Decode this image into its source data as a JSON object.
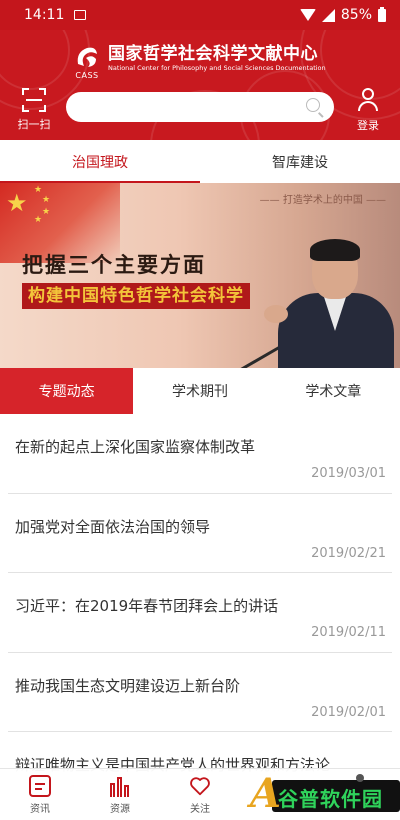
{
  "status_bar": {
    "time": "14:11",
    "battery": "85%"
  },
  "header": {
    "org_name_cn": "国家哲学社会科学文献中心",
    "org_name_en": "National Center for Philosophy and Social Sciences Documentation",
    "logo_label": "CASS",
    "scan_label": "扫一扫",
    "login_label": "登录",
    "search_placeholder": ""
  },
  "top_tabs": [
    {
      "label": "治国理政",
      "active": true
    },
    {
      "label": "智库建设",
      "active": false
    }
  ],
  "banner": {
    "tagline": "—— 打造学术上的中国 ——",
    "headline1": "把握三个主要方面",
    "headline2": "构建中国特色哲学社会科学"
  },
  "sub_tabs": [
    {
      "label": "专题动态",
      "active": true
    },
    {
      "label": "学术期刊",
      "active": false
    },
    {
      "label": "学术文章",
      "active": false
    }
  ],
  "news": [
    {
      "title": "在新的起点上深化国家监察体制改革",
      "date": "2019/03/01"
    },
    {
      "title": "加强党对全面依法治国的领导",
      "date": "2019/02/21"
    },
    {
      "title": "习近平：在2019年春节团拜会上的讲话",
      "date": "2019/02/11"
    },
    {
      "title": "推动我国生态文明建设迈上新台阶",
      "date": "2019/02/01"
    },
    {
      "title": "辩证唯物主义是中国共产党人的世界观和方法论",
      "date": ""
    }
  ],
  "bottom_nav": [
    {
      "label": "资讯",
      "icon": "news-icon"
    },
    {
      "label": "资源",
      "icon": "resources-icon"
    },
    {
      "label": "关注",
      "icon": "heart-icon"
    }
  ],
  "watermark": {
    "text": "谷普软件园"
  },
  "colors": {
    "brand_red": "#c4161c",
    "active_tab_bg": "#d6242a",
    "date_gray": "#999999"
  }
}
